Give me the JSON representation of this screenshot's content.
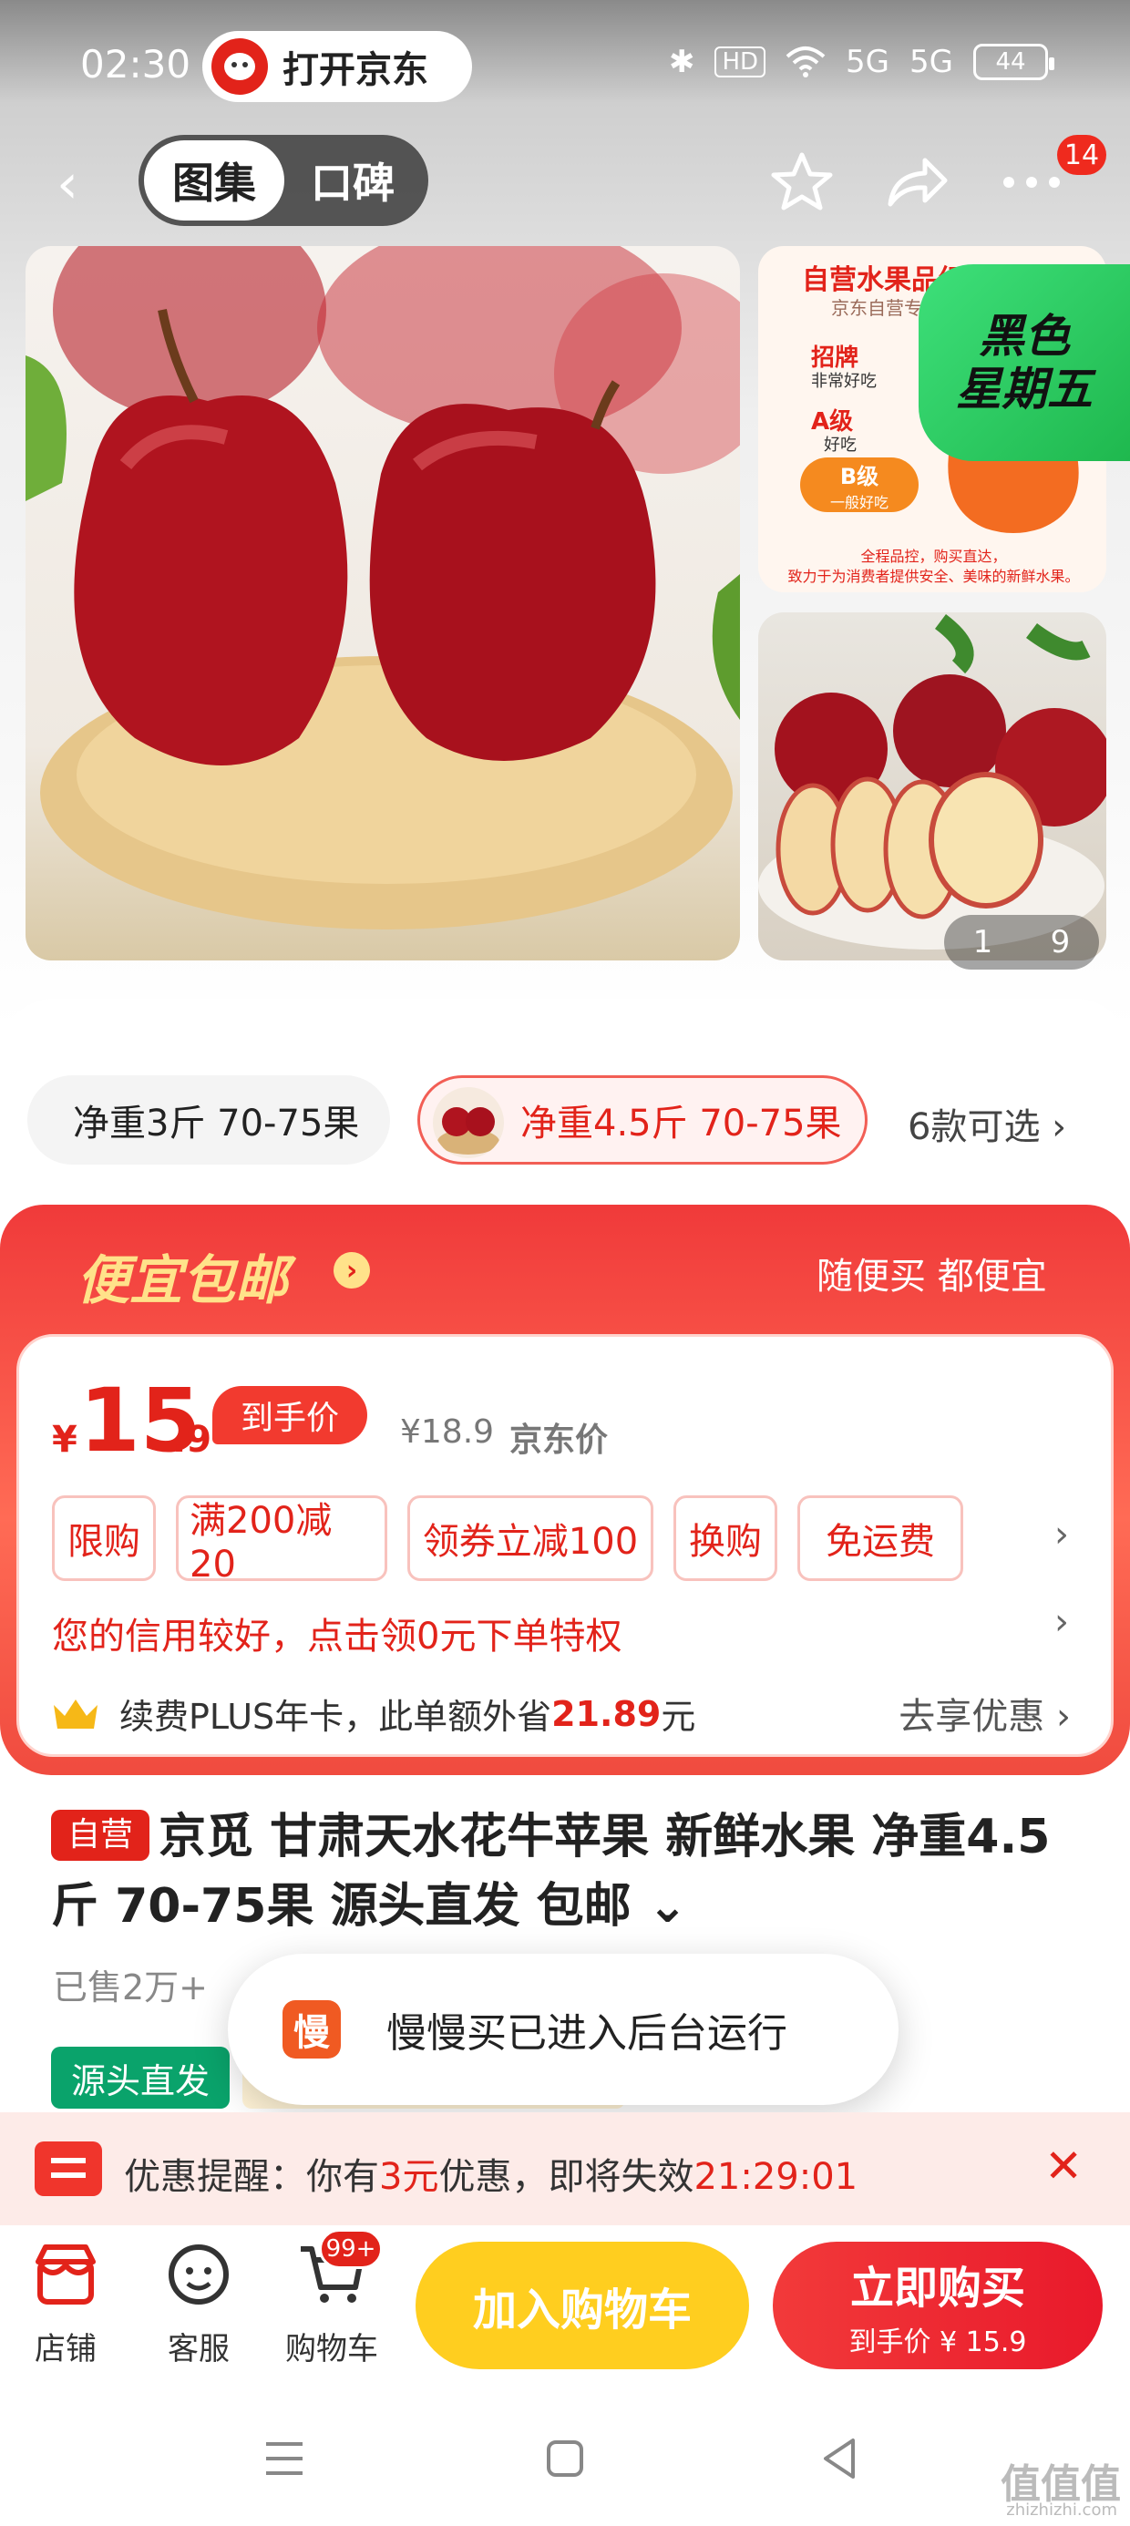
{
  "status_bar": {
    "time": "02:30",
    "open_app_label": "打开京东",
    "hd_label": "HD",
    "signal_1": "5G",
    "signal_2": "5G",
    "battery": "44"
  },
  "nav": {
    "tab_active": "图集",
    "tab_inactive": "口碑",
    "more_badge": "14"
  },
  "gallery": {
    "thumb_title": "自营水果品级标准",
    "thumb_subtitle": "京东自营专业品",
    "grade_a_top": "招牌",
    "grade_a_top_sub": "非常好吃",
    "grade_a": "A级",
    "grade_a_sub": "好吃",
    "grade_b": "B级",
    "grade_b_sub": "一般好吃",
    "thumb_footer_1": "全程品控，购买直达，",
    "thumb_footer_2": "致力于为消费者提供安全、美味的新鲜水果。",
    "promo_1": "黑色",
    "promo_2": "星期五",
    "counter_current": "1",
    "counter_total": "9"
  },
  "variants": {
    "items": [
      {
        "label": "净重3斤 70-75果",
        "selected": false
      },
      {
        "label": "净重4.5斤 70-75果",
        "selected": true
      }
    ],
    "more": "6款可选 ›"
  },
  "promo": {
    "title": "便宜包邮",
    "slogan": "随便买 都便宜",
    "price_symbol": "¥",
    "price_int": "15",
    "price_dec": ".9",
    "price_tag": "到手价",
    "orig_price": "¥18.9",
    "orig_label": "京东价",
    "tags": [
      "限购",
      "满200减20",
      "领券立减100",
      "换购",
      "免运费"
    ],
    "credit": "您的信用较好，点击领0元下单特权",
    "plus_prefix": "续费PLUS年卡，此单额外省",
    "plus_amount": "21.89",
    "plus_suffix": "元",
    "plus_cta": "去享优惠 ›"
  },
  "product": {
    "badge": "自营",
    "title": "京觅 甘肃天水花牛苹果 新鲜水果 净重4.5斤 70-75果 源头直发 包邮",
    "sold": "已售2万+",
    "source_tag": "源头直发"
  },
  "toast": {
    "icon": "慢",
    "text": "慢慢买已进入后台运行"
  },
  "coupon": {
    "prefix": "优惠提醒：你有",
    "amount": "3元",
    "middle": "优惠，即将失效",
    "countdown": "21:29:01"
  },
  "bottom": {
    "store": "店铺",
    "service": "客服",
    "cart": "购物车",
    "cart_badge": "99+",
    "add_cart": "加入购物车",
    "buy_now": "立即购买",
    "buy_sub": "到手价 ¥ 15.9"
  },
  "watermark": {
    "main": "值值值",
    "sub": "zhizhizhi.com"
  },
  "colors": {
    "brand_red": "#e2231a",
    "yellow_button": "#ffce1f",
    "green_tag": "#0aa36b"
  }
}
